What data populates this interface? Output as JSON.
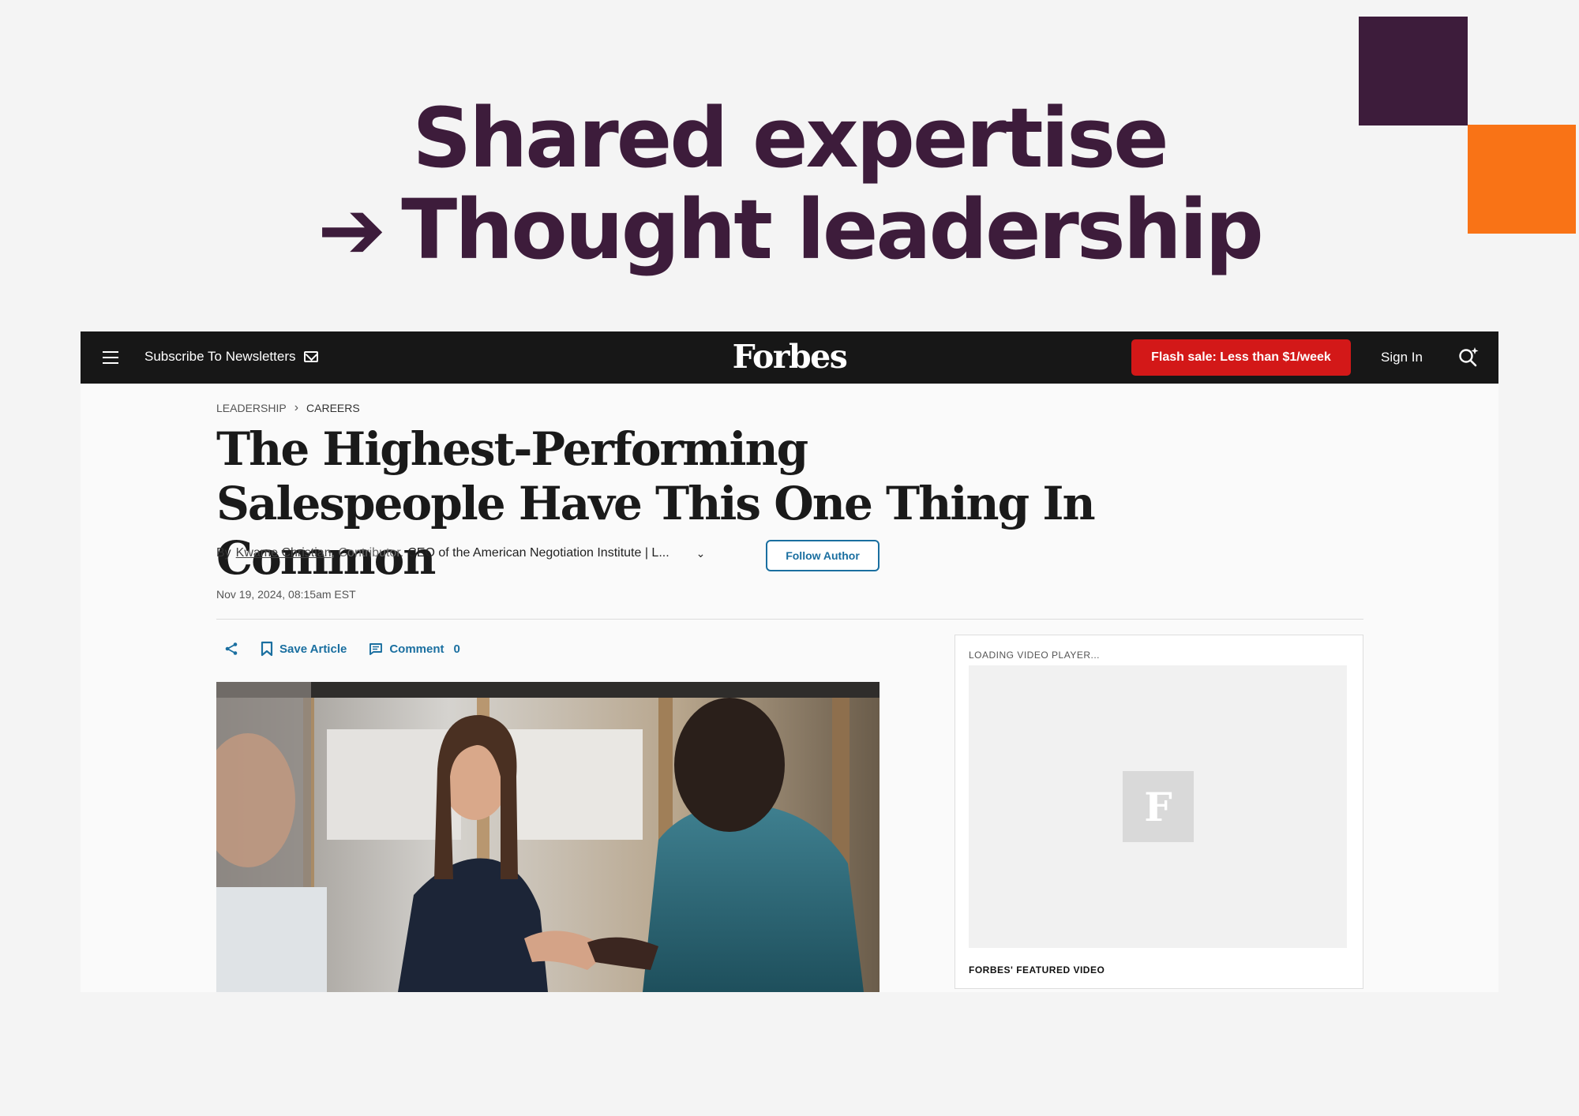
{
  "slide": {
    "title_line1": "Shared expertise",
    "arrow": "➔",
    "title_line2": "Thought leadership",
    "colors": {
      "purple": "#3d1c3b",
      "orange": "#f97316"
    }
  },
  "header": {
    "menu_icon": "hamburger-icon",
    "subscribe_label": "Subscribe To Newsletters",
    "logo": "Forbes",
    "flash_sale_label": "Flash sale: Less than $1/week",
    "sign_in_label": "Sign In",
    "search_icon": "search-sparkle-icon"
  },
  "article": {
    "breadcrumb": [
      "LEADERSHIP",
      "CAREERS"
    ],
    "headline": "The Highest-Performing Salespeople Have This One Thing In Common",
    "byline": {
      "by": "By",
      "author": "Kwame Christian",
      "role": ", Contributor.",
      "bio": "CEO of the American Negotiation Institute | L..."
    },
    "follow_label": "Follow Author",
    "date": "Nov 19, 2024, 08:15am EST",
    "actions": {
      "save_label": "Save Article",
      "comment_label": "Comment",
      "comment_count": "0"
    }
  },
  "video": {
    "loading_label": "LOADING VIDEO PLAYER...",
    "logo_letter": "F",
    "caption": "FORBES' FEATURED VIDEO"
  }
}
